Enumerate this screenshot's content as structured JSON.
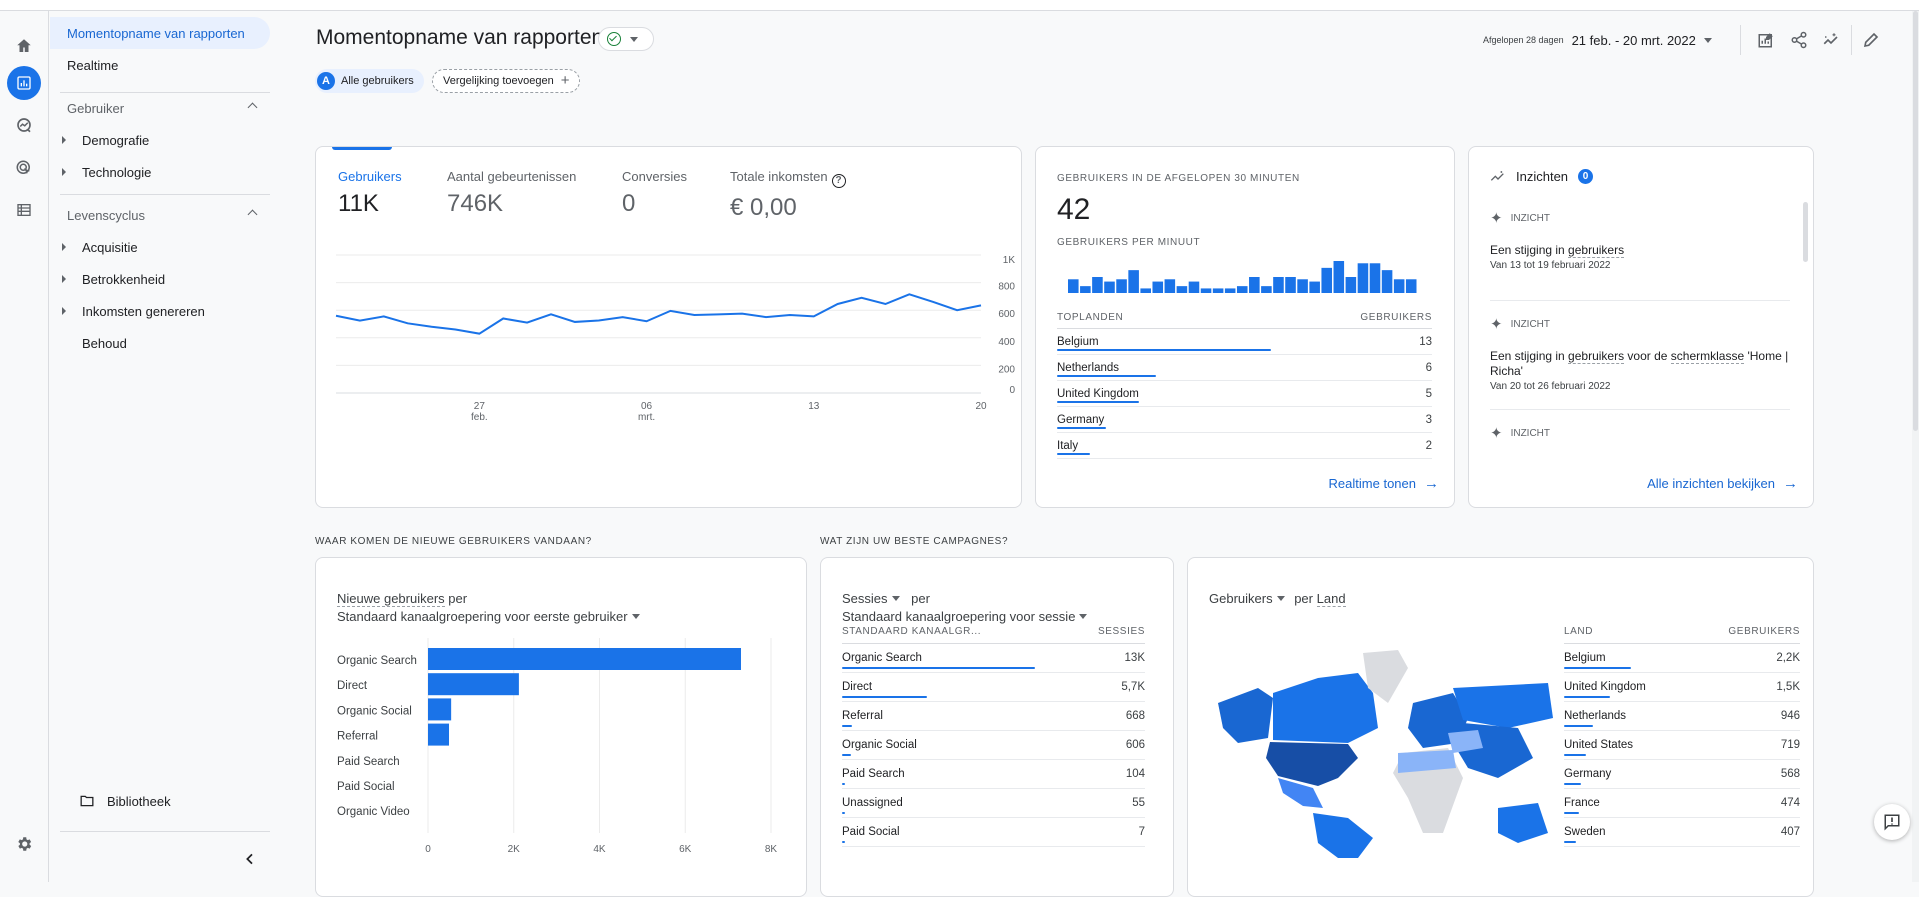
{
  "rail": {
    "items": [
      {
        "icon": "home-icon"
      },
      {
        "icon": "reports-icon",
        "active": true
      },
      {
        "icon": "explore-icon"
      },
      {
        "icon": "advertising-icon"
      },
      {
        "icon": "configure-icon"
      }
    ],
    "settings_icon": "gear-icon"
  },
  "nav": {
    "top_items": [
      {
        "label": "Momentopname van rapporten",
        "active": true
      },
      {
        "label": "Realtime"
      }
    ],
    "sections": [
      {
        "title": "Gebruiker",
        "items": [
          "Demografie",
          "Technologie"
        ]
      },
      {
        "title": "Levenscyclus",
        "items": [
          "Acquisitie",
          "Betrokkenheid",
          "Inkomsten genereren"
        ],
        "plain_items": [
          "Behoud"
        ]
      }
    ],
    "library_label": "Bibliotheek"
  },
  "header": {
    "title": "Momentopname van rapporten",
    "segment_avatar": "A",
    "segment_label": "Alle gebruikers",
    "compare_label": "Vergelijking toevoegen",
    "date_label": "Afgelopen 28 dagen",
    "date_value": "21 feb. - 20 mrt. 2022"
  },
  "overview": {
    "metrics": [
      {
        "label": "Gebruikers",
        "value": "11K",
        "active": true
      },
      {
        "label": "Aantal gebeurtenissen",
        "value": "746K"
      },
      {
        "label": "Conversies",
        "value": "0"
      },
      {
        "label": "Totale inkomsten",
        "value": "€ 0,00",
        "help": "?"
      }
    ]
  },
  "realtime": {
    "title": "Gebruikers in de afgelopen 30 minuten",
    "value": "42",
    "subtitle": "Gebruikers per minuut",
    "per_minute": [
      3,
      1.5,
      3.5,
      2.5,
      3,
      5,
      1,
      2.5,
      3,
      1.5,
      2.5,
      1,
      1,
      1,
      1.5,
      3.5,
      1.5,
      3.5,
      3.5,
      3,
      2.5,
      5.5,
      7,
      3.5,
      6.5,
      6.5,
      5,
      3,
      3
    ],
    "col_country": "Toplanden",
    "col_users": "Gebruikers",
    "rows": [
      {
        "country": "Belgium",
        "value": "13",
        "n": 13
      },
      {
        "country": "Netherlands",
        "value": "6",
        "n": 6
      },
      {
        "country": "United Kingdom",
        "value": "5",
        "n": 5
      },
      {
        "country": "Germany",
        "value": "3",
        "n": 3
      },
      {
        "country": "Italy",
        "value": "2",
        "n": 2
      }
    ],
    "link": "Realtime tonen"
  },
  "insights": {
    "title": "Inzichten",
    "badge": "0",
    "tag": "INZICHT",
    "items": [
      {
        "pre": "Een stijging in ",
        "dash": "gebruikers",
        "mid": "",
        "dash2": "",
        "post": "",
        "date": "Van 13 tot 19 februari 2022"
      },
      {
        "pre": "Een stijging in ",
        "dash": "gebruikers",
        "mid": " voor de ",
        "dash2": "schermklasse",
        "post": " 'Home | Richa'",
        "date": "Van 20 tot 26 februari 2022"
      },
      {
        "pre": "",
        "dash": "",
        "mid": "",
        "dash2": "",
        "post": "",
        "date": ""
      }
    ],
    "link": "Alle inzichten bekijken"
  },
  "new_users": {
    "section_title": "WAAR KOMEN DE NIEUWE GEBRUIKERS VANDAAN?",
    "metric": "Nieuwe gebruikers",
    "per": " per",
    "dimension": "Standaard kanaalgroepering voor eerste gebruiker"
  },
  "campaigns": {
    "section_title": "WAT ZIJN UW BESTE CAMPAGNES?",
    "metric": "Sessies",
    "per": "per",
    "dimension": "Standaard kanaalgroepering voor sessie",
    "col_dim": "STANDAARD KANAALGR...",
    "col_val": "SESSIES",
    "rows": [
      {
        "label": "Organic Search",
        "value": "13K",
        "n": 13000
      },
      {
        "label": "Direct",
        "value": "5,7K",
        "n": 5700
      },
      {
        "label": "Referral",
        "value": "668",
        "n": 668
      },
      {
        "label": "Organic Social",
        "value": "606",
        "n": 606
      },
      {
        "label": "Paid Search",
        "value": "104",
        "n": 104
      },
      {
        "label": "Unassigned",
        "value": "55",
        "n": 55
      },
      {
        "label": "Paid Social",
        "value": "7",
        "n": 7
      }
    ]
  },
  "countries": {
    "metric": "Gebruikers",
    "per": "per",
    "dimension": "Land",
    "col_dim": "LAND",
    "col_val": "GEBRUIKERS",
    "rows": [
      {
        "label": "Belgium",
        "value": "2,2K",
        "n": 2200
      },
      {
        "label": "United Kingdom",
        "value": "1,5K",
        "n": 1500
      },
      {
        "label": "Netherlands",
        "value": "946",
        "n": 946
      },
      {
        "label": "United States",
        "value": "719",
        "n": 719
      },
      {
        "label": "Germany",
        "value": "568",
        "n": 568
      },
      {
        "label": "France",
        "value": "474",
        "n": 474
      },
      {
        "label": "Sweden",
        "value": "407",
        "n": 407
      }
    ]
  },
  "chart_data": [
    {
      "type": "line",
      "title": "Gebruikers",
      "x": [
        "21",
        "22",
        "23",
        "24",
        "25",
        "26",
        "27",
        "28",
        "01",
        "02",
        "03",
        "04",
        "05",
        "06",
        "07",
        "08",
        "09",
        "10",
        "11",
        "12",
        "13",
        "14",
        "15",
        "16",
        "17",
        "18",
        "19",
        "20"
      ],
      "series": [
        {
          "name": "Gebruikers",
          "values": [
            560,
            525,
            555,
            505,
            480,
            460,
            430,
            540,
            510,
            570,
            515,
            525,
            550,
            520,
            595,
            565,
            570,
            575,
            550,
            565,
            555,
            645,
            690,
            645,
            715,
            660,
            600,
            635
          ]
        }
      ],
      "xticks": [
        {
          "label": "27",
          "sub": "feb.",
          "index": 6
        },
        {
          "label": "06",
          "sub": "mrt.",
          "index": 13
        },
        {
          "label": "13",
          "sub": "",
          "index": 20
        },
        {
          "label": "20",
          "sub": "",
          "index": 27
        }
      ],
      "yticks": [
        "0",
        "200",
        "400",
        "600",
        "800",
        "1K"
      ],
      "ylim": [
        0,
        1000
      ],
      "grid": true,
      "y_axis_side": "right"
    },
    {
      "type": "bar",
      "orientation": "horizontal",
      "title": "Nieuwe gebruikers per Standaard kanaalgroepering voor eerste gebruiker",
      "categories": [
        "Organic Search",
        "Direct",
        "Organic Social",
        "Referral",
        "Paid Search",
        "Paid Social",
        "Organic Video"
      ],
      "values": [
        7300,
        2120,
        540,
        490,
        0,
        0,
        0
      ],
      "xticks": [
        "0",
        "2K",
        "4K",
        "6K",
        "8K"
      ],
      "xlim": [
        0,
        8000
      ],
      "grid": true
    }
  ]
}
